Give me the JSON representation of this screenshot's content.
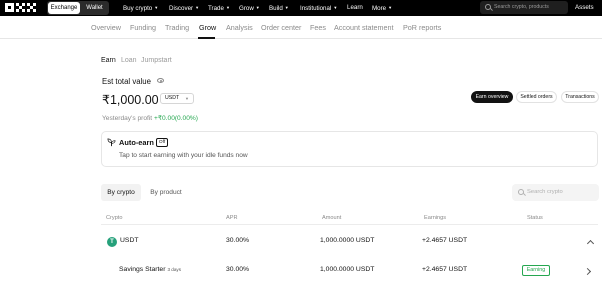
{
  "topnav": {
    "segment": {
      "exchange": "Exchange",
      "wallet": "Wallet"
    },
    "items": [
      {
        "label": "Buy crypto",
        "chevron": true
      },
      {
        "label": "Discover",
        "chevron": true
      },
      {
        "label": "Trade",
        "chevron": true
      },
      {
        "label": "Grow",
        "chevron": true
      },
      {
        "label": "Build",
        "chevron": true
      },
      {
        "label": "Institutional",
        "chevron": true
      },
      {
        "label": "Learn",
        "chevron": false
      },
      {
        "label": "More",
        "chevron": true
      }
    ],
    "search_placeholder": "Search crypto, products",
    "assets": "Assets"
  },
  "subnav": {
    "tabs": [
      "Overview",
      "Funding",
      "Trading",
      "Grow",
      "Analysis",
      "Order center",
      "Fees",
      "Account statement",
      "PoR reports"
    ],
    "active": "Grow"
  },
  "earn": {
    "tabs": [
      "Earn",
      "Loan",
      "Jumpstart"
    ],
    "active_tab": "Earn",
    "est_label": "Est total value",
    "amount": "₹1,000.00",
    "currency": "USDT",
    "yprofit_label": "Yesterday's profit",
    "yprofit_value": "+₹0.00(0.00%)",
    "buttons": [
      "Earn overview",
      "Settled orders",
      "Transactions"
    ]
  },
  "auto_earn": {
    "title": "Auto-earn",
    "badge": "Off",
    "subtitle": "Tap to start earning with your idle funds now"
  },
  "table": {
    "tabs": [
      "By crypto",
      "By product"
    ],
    "search_placeholder": "Search crypto",
    "headers": [
      "Crypto",
      "APR",
      "Amount",
      "Earnings",
      "Status"
    ],
    "coin_row": {
      "icon": "T",
      "crypto": "USDT",
      "apr": "30.00%",
      "amount": "1,000.0000 USDT",
      "earnings": "+2.4657 USDT"
    },
    "product_row": {
      "name": "Savings Starter",
      "days": "3 days",
      "apr": "30.00%",
      "amount": "1,000.0000 USDT",
      "earnings": "+2.4657 USDT",
      "status": "Earning"
    }
  },
  "colors": {
    "positive": "#25a750",
    "usdt": "#26a17b",
    "nav_bg": "#000000"
  }
}
